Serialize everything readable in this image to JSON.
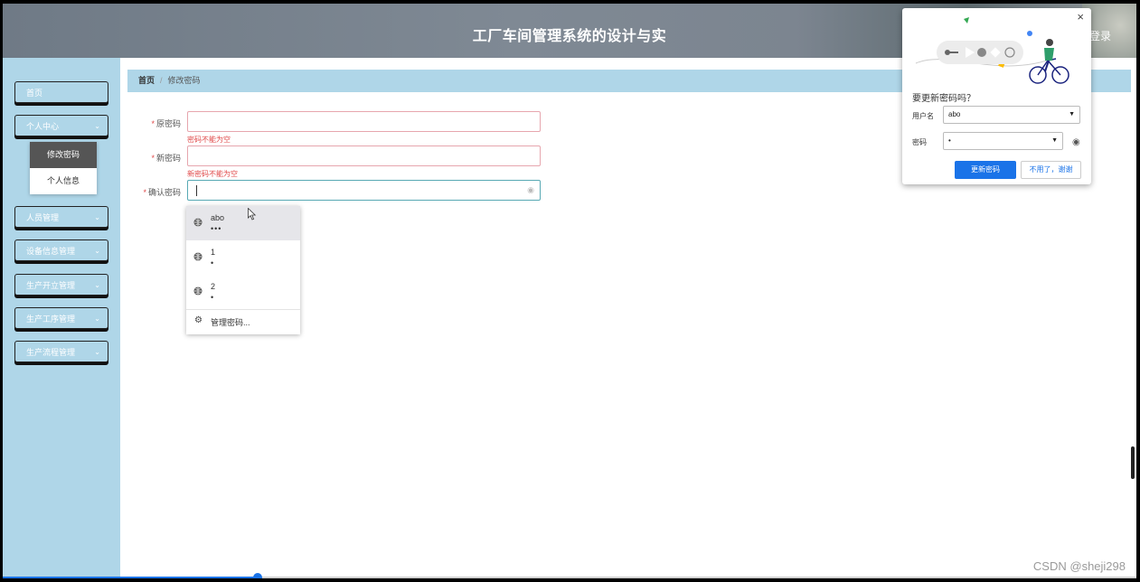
{
  "header": {
    "title": "工厂车间管理系统的设计与实",
    "logout": "登录"
  },
  "sidebar": {
    "items": [
      {
        "label": "首页",
        "has_chevron": false
      },
      {
        "label": "个人中心",
        "has_chevron": true
      },
      {
        "label": "人员管理",
        "has_chevron": true
      },
      {
        "label": "设备信息管理",
        "has_chevron": true
      },
      {
        "label": "生产开立管理",
        "has_chevron": true
      },
      {
        "label": "生产工序管理",
        "has_chevron": true
      },
      {
        "label": "生产流程管理",
        "has_chevron": true
      }
    ],
    "submenu": [
      {
        "label": "修改密码",
        "active": true
      },
      {
        "label": "个人信息",
        "active": false
      }
    ]
  },
  "breadcrumb": {
    "home": "首页",
    "separator": "/",
    "current": "修改密码"
  },
  "form": {
    "required_mark": "*",
    "fields": [
      {
        "label": "原密码",
        "value": "",
        "error": "密码不能为空"
      },
      {
        "label": "新密码",
        "value": "",
        "error": "新密码不能为空"
      },
      {
        "label": "确认密码",
        "value": "",
        "error": ""
      }
    ]
  },
  "autofill": {
    "items": [
      {
        "username": "abo",
        "password_mask": "•••",
        "selected": true
      },
      {
        "username": "1",
        "password_mask": "•",
        "selected": false
      },
      {
        "username": "2",
        "password_mask": "•",
        "selected": false
      }
    ],
    "manage_label": "管理密码..."
  },
  "popup": {
    "question": "要更新密码吗？",
    "username_label": "用户名",
    "username_value": "abo",
    "password_label": "密码",
    "password_value": "•",
    "update_button": "更新密码",
    "dismiss_button": "不用了，谢谢"
  },
  "progress": {
    "fraction": 0.225
  },
  "watermark": "CSDN @sheji298",
  "colors": {
    "accent": "#1a73e8",
    "sidebar": "#afd6e8",
    "error": "#e04a4a",
    "focus": "#58a9b4"
  },
  "icons": {
    "close": "close-icon",
    "globe": "globe-icon",
    "gear": "gear-icon",
    "eye": "eye-icon",
    "chevron": "chevron-down-icon",
    "cursor": "mouse-cursor-icon"
  }
}
